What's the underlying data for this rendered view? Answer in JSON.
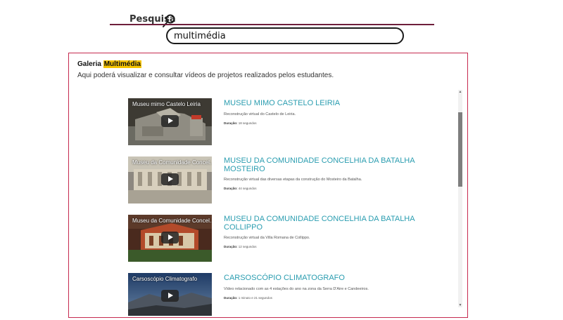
{
  "search": {
    "title": "Pesquisa",
    "value": "multimédia",
    "icon": "magnifier-icon"
  },
  "gallery": {
    "heading_prefix": "Galeria ",
    "heading_highlight": "Multimédia",
    "description": "Aqui poderá visualizar e consultar vídeos de projetos realizados pelos estudantes."
  },
  "videos": [
    {
      "thumb_caption": "Museu mimo Castelo Leiria",
      "title": "MUSEU MIMO CASTELO LEIRIA",
      "description": "Reconstrução virtual do Castelo de Leiria.",
      "duration_label": "Duração:",
      "duration": "18 segundos"
    },
    {
      "thumb_caption": "Museu da Comunidade Concel...",
      "title": "MUSEU DA COMUNIDADE CONCELHIA DA BATALHA MOSTEIRO",
      "description": "Reconstrução virtual das diversas etapas da construção do Mosteiro da Batalha.",
      "duration_label": "Duração:",
      "duration": "44 segundos"
    },
    {
      "thumb_caption": "Museu da Comunidade Concel...",
      "title": "MUSEU DA COMUNIDADE CONCELHIA DA BATALHA COLLIPPO",
      "description": "Reconstrução virtual da Villa Romana de Collippo.",
      "duration_label": "Duração:",
      "duration": "12 segundos"
    },
    {
      "thumb_caption": "Carsoscópio Climatografo",
      "title": "CARSOSCÓPIO CLIMATOGRAFO",
      "description": "Vídeo relacionado com as 4 estações do ano na zona da Serra D'Aire e Candeeiros.",
      "duration_label": "Duração:",
      "duration": "1 minuto e 21 segundos"
    }
  ],
  "colors": {
    "accent_line": "#6e1f3b",
    "panel_border": "#c62a4f",
    "highlight": "#f5c400",
    "video_title": "#2a9db0"
  }
}
